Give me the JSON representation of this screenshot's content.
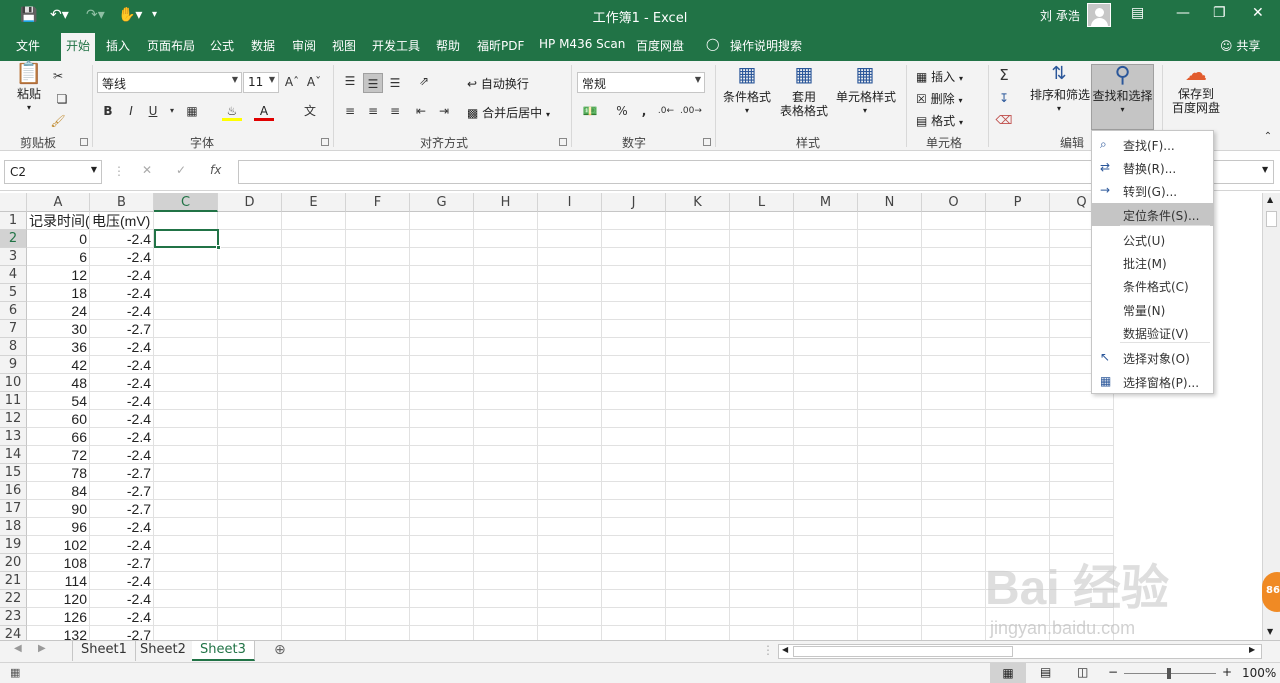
{
  "titlebar": {
    "title": "工作簿1  -  Excel",
    "user": "刘 承浩",
    "icons": [
      "save-icon",
      "undo-icon",
      "redo-icon",
      "touch-mode-icon",
      "customize-icon"
    ]
  },
  "tabs": [
    "文件",
    "开始",
    "插入",
    "页面布局",
    "公式",
    "数据",
    "审阅",
    "视图",
    "开发工具",
    "帮助",
    "福昕PDF",
    "HP M436 Scan",
    "百度网盘"
  ],
  "tell_me": "操作说明搜索",
  "share": "共享",
  "ribbon": {
    "clipboard": {
      "paste": "粘贴",
      "label": "剪贴板"
    },
    "font": {
      "name": "等线",
      "size": "11",
      "label": "字体",
      "bold": "B",
      "italic": "I",
      "underline": "U"
    },
    "alignment": {
      "wrap": "自动换行",
      "merge": "合并后居中",
      "label": "对齐方式"
    },
    "number": {
      "format": "常规",
      "label": "数字",
      "percent": "%",
      "comma": ","
    },
    "styles": {
      "cond": "条件格式",
      "table": "套用",
      "table2": "表格格式",
      "cell": "单元格样式",
      "label": "样式"
    },
    "cells": {
      "insert": "插入",
      "delete": "删除",
      "format": "格式",
      "label": "单元格"
    },
    "editing": {
      "sort": "排序和筛选",
      "find": "查找和选择",
      "label": "编辑"
    },
    "save": {
      "line1": "保存到",
      "line2": "百度网盘"
    }
  },
  "formula": {
    "namebox": "C2",
    "fx": "fx",
    "value": ""
  },
  "columns": [
    "A",
    "B",
    "C",
    "D",
    "E",
    "F",
    "G",
    "H",
    "I",
    "J",
    "K",
    "L",
    "M",
    "N",
    "O",
    "P",
    "Q"
  ],
  "rows": [
    {
      "n": "1",
      "a": "记录时间(s)",
      "b": "电压(mV)"
    },
    {
      "n": "2",
      "a": "0",
      "b": "-2.4"
    },
    {
      "n": "3",
      "a": "6",
      "b": "-2.4"
    },
    {
      "n": "4",
      "a": "12",
      "b": "-2.4"
    },
    {
      "n": "5",
      "a": "18",
      "b": "-2.4"
    },
    {
      "n": "6",
      "a": "24",
      "b": "-2.4"
    },
    {
      "n": "7",
      "a": "30",
      "b": "-2.7"
    },
    {
      "n": "8",
      "a": "36",
      "b": "-2.4"
    },
    {
      "n": "9",
      "a": "42",
      "b": "-2.4"
    },
    {
      "n": "10",
      "a": "48",
      "b": "-2.4"
    },
    {
      "n": "11",
      "a": "54",
      "b": "-2.4"
    },
    {
      "n": "12",
      "a": "60",
      "b": "-2.4"
    },
    {
      "n": "13",
      "a": "66",
      "b": "-2.4"
    },
    {
      "n": "14",
      "a": "72",
      "b": "-2.4"
    },
    {
      "n": "15",
      "a": "78",
      "b": "-2.7"
    },
    {
      "n": "16",
      "a": "84",
      "b": "-2.7"
    },
    {
      "n": "17",
      "a": "90",
      "b": "-2.7"
    },
    {
      "n": "18",
      "a": "96",
      "b": "-2.4"
    },
    {
      "n": "19",
      "a": "102",
      "b": "-2.4"
    },
    {
      "n": "20",
      "a": "108",
      "b": "-2.7"
    },
    {
      "n": "21",
      "a": "114",
      "b": "-2.4"
    },
    {
      "n": "22",
      "a": "120",
      "b": "-2.4"
    },
    {
      "n": "23",
      "a": "126",
      "b": "-2.4"
    },
    {
      "n": "24",
      "a": "132",
      "b": "-2.7"
    }
  ],
  "sheets": [
    "Sheet1",
    "Sheet2",
    "Sheet3"
  ],
  "active_sheet": "Sheet3",
  "find_menu": [
    {
      "label": "查找(F)...",
      "icon": "search-icon"
    },
    {
      "label": "替换(R)...",
      "icon": "replace-icon"
    },
    {
      "label": "转到(G)...",
      "icon": "arrow-right-icon"
    },
    {
      "label": "定位条件(S)...",
      "icon": "",
      "highlight": true
    },
    {
      "label": "公式(U)",
      "icon": ""
    },
    {
      "label": "批注(M)",
      "icon": ""
    },
    {
      "label": "条件格式(C)",
      "icon": ""
    },
    {
      "label": "常量(N)",
      "icon": ""
    },
    {
      "label": "数据验证(V)",
      "icon": ""
    },
    {
      "label": "选择对象(O)",
      "icon": "cursor-icon"
    },
    {
      "label": "选择窗格(P)...",
      "icon": "selection-pane-icon"
    }
  ],
  "status": {
    "zoom": "100%"
  },
  "watermark": {
    "main": "Bai 经验",
    "url": "jingyan.baidu.com"
  },
  "colors": {
    "excel_green": "#217346",
    "ribbon_bg": "#f3f3f3"
  }
}
